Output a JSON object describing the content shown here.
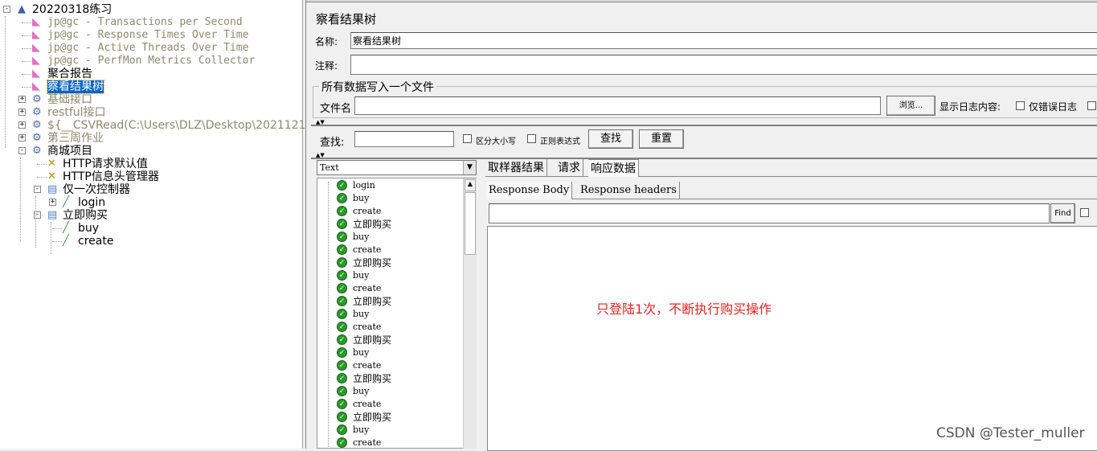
{
  "tree": [
    {
      "label": "20220318练习",
      "level": 0,
      "icon": "test-plan-icon",
      "state": "normal",
      "expander": "-"
    },
    {
      "label": "jp@gc - Transactions per Second",
      "level": 1,
      "icon": "graph-listener-icon",
      "state": "disabled",
      "mono": true
    },
    {
      "label": "jp@gc - Response Times Over Time",
      "level": 1,
      "icon": "graph-listener-icon",
      "state": "disabled",
      "mono": true
    },
    {
      "label": "jp@gc - Active Threads Over Time",
      "level": 1,
      "icon": "graph-listener-icon",
      "state": "disabled",
      "mono": true
    },
    {
      "label": "jp@gc - PerfMon Metrics Collector",
      "level": 1,
      "icon": "graph-listener-icon",
      "state": "disabled",
      "mono": true
    },
    {
      "label": "聚合报告",
      "level": 1,
      "icon": "graph-listener-icon",
      "state": "normal"
    },
    {
      "label": "察看结果树",
      "level": 1,
      "icon": "graph-listener-icon",
      "state": "selected"
    },
    {
      "label": "基础接口",
      "level": 1,
      "icon": "thread-group-gear-icon",
      "state": "disabled",
      "expander": "+"
    },
    {
      "label": "restful接口",
      "level": 1,
      "icon": "thread-group-gear-icon",
      "state": "disabled",
      "expander": "+"
    },
    {
      "label": "${__CSVRead(C:\\Users\\DLZ\\Desktop\\2021121",
      "level": 1,
      "icon": "thread-group-gear-icon",
      "state": "disabled",
      "expander": "+"
    },
    {
      "label": "第三周作业",
      "level": 1,
      "icon": "thread-group-gear-icon",
      "state": "disabled",
      "expander": "+"
    },
    {
      "label": "商城项目",
      "level": 1,
      "icon": "thread-group-gear-icon",
      "state": "normal",
      "expander": "-"
    },
    {
      "label": "HTTP请求默认值",
      "level": 2,
      "icon": "config-tools-icon",
      "state": "normal"
    },
    {
      "label": "HTTP信息头管理器",
      "level": 2,
      "icon": "config-tools-icon",
      "state": "normal"
    },
    {
      "label": "仅一次控制器",
      "level": 2,
      "icon": "controller-icon",
      "state": "normal",
      "expander": "-"
    },
    {
      "label": "login",
      "level": 3,
      "icon": "sampler-pipette-icon",
      "state": "normal",
      "expander": "+"
    },
    {
      "label": "立即购买",
      "level": 2,
      "icon": "controller-icon",
      "state": "normal",
      "expander": "-"
    },
    {
      "label": "buy",
      "level": 3,
      "icon": "sampler-pipette-icon",
      "state": "normal"
    },
    {
      "label": "create",
      "level": 3,
      "icon": "sampler-pipette-icon",
      "state": "normal"
    }
  ],
  "panel": {
    "title": "察看结果树",
    "name_label": "名称:",
    "name_value": "察看结果树",
    "comment_label": "注释:",
    "comment_value": "",
    "file_group": "所有数据写入一个文件",
    "file_label": "文件名",
    "file_value": "",
    "browse": "浏览...",
    "log_label": "显示日志内容:",
    "errors_only": "仅错误日志",
    "search_label": "查找:",
    "search_value": "",
    "case_sensitive": "区分大小写",
    "regex": "正则表达式",
    "find_btn": "查找",
    "reset_btn": "重置",
    "renderer": "Text",
    "tabs": [
      "取样器结果",
      "请求",
      "响应数据"
    ],
    "active_tab": 2,
    "subtabs": [
      "Response Body",
      "Response headers"
    ],
    "find_small": "Find",
    "response_text": "只登陆1次，不断执行购买操作"
  },
  "results": [
    "login",
    "buy",
    "create",
    "立即购买",
    "buy",
    "create",
    "立即购买",
    "buy",
    "create",
    "立即购买",
    "buy",
    "create",
    "立即购买",
    "buy",
    "create",
    "立即购买",
    "buy",
    "create",
    "立即购买",
    "buy",
    "create"
  ],
  "watermark": "CSDN @Tester_muller",
  "colors": {
    "selection": "#0a64c8",
    "disabled": "#8a8a6e",
    "success": "#2a9a2a",
    "annotation": "#e8221f"
  }
}
